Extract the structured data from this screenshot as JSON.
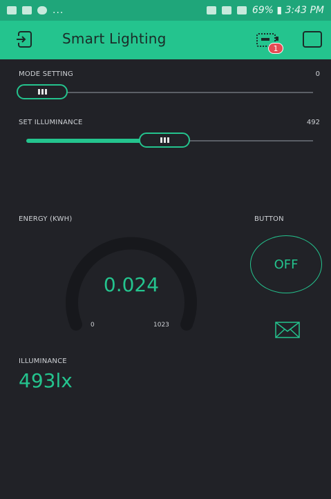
{
  "status_bar": {
    "left_dots": "...",
    "right_text": "69% ▮ 3:43 PM"
  },
  "app_bar": {
    "title": "Smart Lighting",
    "notification_count": "1"
  },
  "mode_setting": {
    "label": "MODE SETTING",
    "value": "0",
    "fraction": 0
  },
  "set_illuminance": {
    "label": "SET ILLUMINANCE",
    "value": "492",
    "fraction": 0.48
  },
  "energy": {
    "label": "ENERGY (KWH)",
    "value": "0.024",
    "min": "0",
    "max": "1023"
  },
  "button_widget": {
    "label": "BUTTON",
    "state": "OFF"
  },
  "illuminance": {
    "label": "ILLUMINANCE",
    "value": "493lx"
  },
  "colors": {
    "accent": "#24c48e",
    "background": "#212227",
    "status_bar": "#1fa67a",
    "badge": "#e54b54"
  },
  "icons": {
    "back": "exit-app-icon",
    "device": "device-status-icon",
    "square": "square-outline-icon",
    "mail": "mail-icon"
  }
}
